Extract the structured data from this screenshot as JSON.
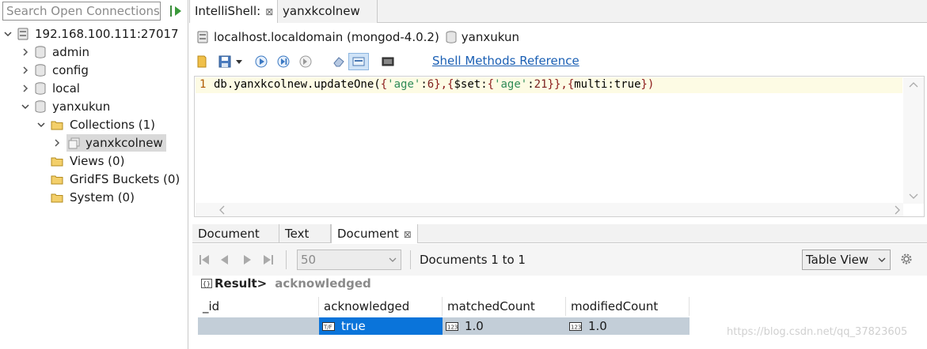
{
  "sidebar": {
    "search_placeholder": "Search Open Connections (",
    "tree": {
      "server": "192.168.100.111:27017",
      "databases": [
        "admin",
        "config",
        "local"
      ],
      "open_db": "yanxukun",
      "collections": "Collections (1)",
      "collection_item": "yanxkcolnew",
      "views": "Views (0)",
      "gridfs": "GridFS Buckets (0)",
      "system": "System (0)"
    }
  },
  "tabs": [
    {
      "label": "IntelliShell:",
      "close": "⊠"
    },
    {
      "label": "yanxkcolnew"
    }
  ],
  "connection": {
    "host": "localhost.localdomain (mongod-4.0.2)",
    "database": "yanxukun"
  },
  "toolbar": {
    "shell_ref_link": "Shell Methods Reference"
  },
  "editor": {
    "line_number": "1",
    "code_parts": {
      "p1": "db.yanxkcolnew.updateOne(",
      "p2": "{",
      "p3": "'age'",
      "p4": ":",
      "p5": "6",
      "p6": "},{",
      "p7": "$set:",
      "p8": "{",
      "p9": "'age'",
      "p10": ":",
      "p11": "21",
      "p12": "}},{",
      "p13": "multi:true",
      "p14": "})"
    }
  },
  "result_tabs": [
    {
      "label": "Document"
    },
    {
      "label": "Text"
    },
    {
      "label": "Document",
      "close": "⊠"
    }
  ],
  "pager": {
    "page_size": "50",
    "doc_count": "Documents 1 to 1",
    "view_mode": "Table View"
  },
  "result": {
    "label": "Result>",
    "path": "acknowledged"
  },
  "table": {
    "columns": [
      "_id",
      "acknowledged",
      "matchedCount",
      "modifiedCount"
    ],
    "row": [
      "",
      "true",
      "1.0",
      "1.0"
    ]
  },
  "watermark": "https://blog.csdn.net/qq_37823605",
  "colors": {
    "link": "#1a5fb4",
    "selected_cell": "#0a74da",
    "row_bg": "#c3ced8"
  }
}
